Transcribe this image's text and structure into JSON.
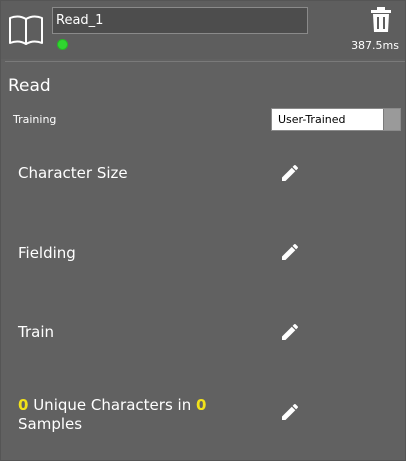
{
  "header": {
    "tool_name": "Read_1",
    "timing": "387.5ms",
    "status_color": "#2fd62f",
    "book_icon": "book-icon",
    "delete_icon": "trash-icon"
  },
  "section": {
    "title": "Read"
  },
  "training": {
    "label": "Training",
    "selected": "User-Trained"
  },
  "rows": [
    {
      "label": "Character Size",
      "icon": "pencil-icon"
    },
    {
      "label": "Fielding",
      "icon": "pencil-icon"
    },
    {
      "label": "Train",
      "icon": "pencil-icon"
    }
  ],
  "summary": {
    "unique_count": "0",
    "text_mid": " Unique Characters in ",
    "sample_count": "0",
    "text_end": "Samples",
    "icon": "pencil-icon"
  },
  "colors": {
    "background": "#616161",
    "highlight": "#f2e21a"
  }
}
